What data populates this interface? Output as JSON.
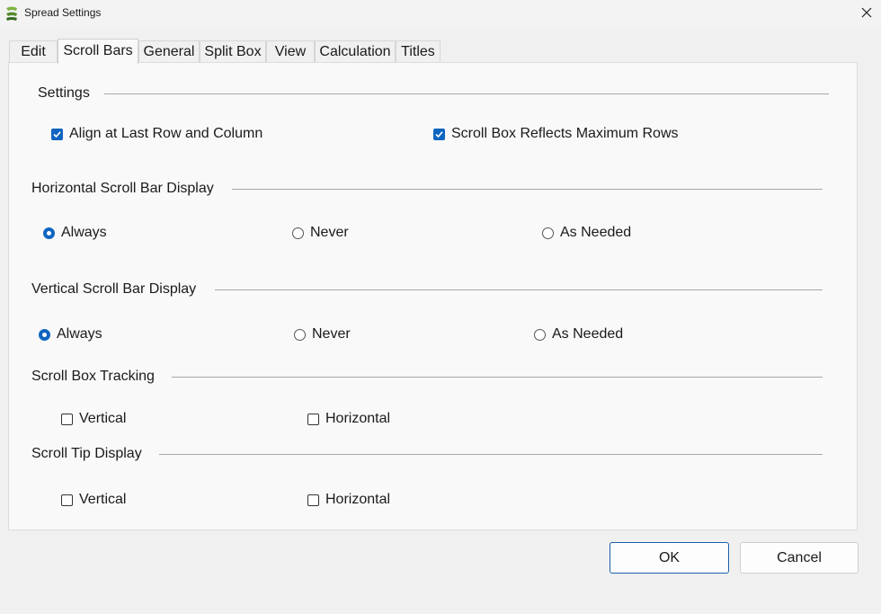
{
  "window": {
    "title": "Spread Settings",
    "app_icon": "spread-logo-icon",
    "close_icon": "close-icon",
    "accent_color": "#0f65c0"
  },
  "tabs": [
    {
      "label": "Edit",
      "active": false
    },
    {
      "label": "Scroll Bars",
      "active": true
    },
    {
      "label": "General",
      "active": false
    },
    {
      "label": "Split Box",
      "active": false
    },
    {
      "label": "View",
      "active": false
    },
    {
      "label": "Calculation",
      "active": false
    },
    {
      "label": "Titles",
      "active": false
    }
  ],
  "settings": {
    "title": "Settings",
    "align_last": {
      "label": "Align at Last Row and Column",
      "checked": true
    },
    "scroll_box_max": {
      "label": "Scroll Box Reflects Maximum Rows",
      "checked": true
    }
  },
  "horizontal_display": {
    "title": "Horizontal Scroll Bar Display",
    "options": [
      "Always",
      "Never",
      "As Needed"
    ],
    "selected": "Always"
  },
  "vertical_display": {
    "title": "Vertical Scroll Bar Display",
    "options": [
      "Always",
      "Never",
      "As Needed"
    ],
    "selected": "Always"
  },
  "scroll_box_tracking": {
    "title": "Scroll Box Tracking",
    "vertical": {
      "label": "Vertical",
      "checked": false
    },
    "horizontal": {
      "label": "Horizontal",
      "checked": false
    }
  },
  "scroll_tip_display": {
    "title": "Scroll Tip Display",
    "vertical": {
      "label": "Vertical",
      "checked": false
    },
    "horizontal": {
      "label": "Horizontal",
      "checked": false
    }
  },
  "buttons": {
    "ok": "OK",
    "cancel": "Cancel"
  }
}
